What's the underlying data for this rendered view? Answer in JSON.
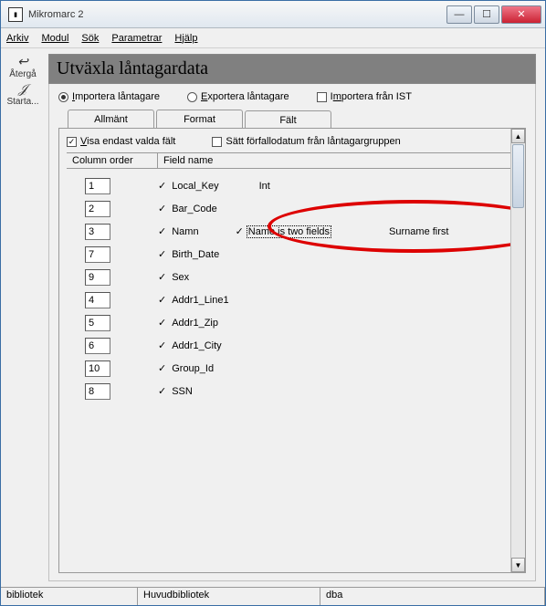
{
  "window": {
    "title": "Mikromarc 2"
  },
  "menu": {
    "arkiv": "Arkiv",
    "modul": "Modul",
    "sok": "Sök",
    "parametrar": "Parametrar",
    "hjalp": "Hjälp"
  },
  "toolbar": {
    "atergal": "Återgå",
    "starta": "Starta..."
  },
  "page_title": "Utväxla låntagardata",
  "radios": {
    "import": "Importera låntagare",
    "export": "Exportera låntagare",
    "ist": "Importera från IST"
  },
  "tabs": {
    "allmant": "Allmänt",
    "format": "Format",
    "falt": "Fält"
  },
  "options": {
    "visa_valda": "Visa endast valda fält",
    "satt_forfallo": "Sätt förfallodatum från låntagargruppen"
  },
  "grid": {
    "header": {
      "col_order": "Column order",
      "field_name": "Field name"
    },
    "rows": [
      {
        "order": "1",
        "name": "Local_Key",
        "checked": true,
        "extras": [
          {
            "label": "Int",
            "checked": false
          }
        ]
      },
      {
        "order": "2",
        "name": "Bar_Code",
        "checked": true
      },
      {
        "order": "3",
        "name": "Namn",
        "checked": true,
        "extras": [
          {
            "label": "Name is two fields",
            "checked": true,
            "focus": true
          },
          {
            "label": "Surname first",
            "checked": false
          }
        ]
      },
      {
        "order": "7",
        "name": "Birth_Date",
        "checked": true
      },
      {
        "order": "9",
        "name": "Sex",
        "checked": true
      },
      {
        "order": "4",
        "name": "Addr1_Line1",
        "checked": true
      },
      {
        "order": "5",
        "name": "Addr1_Zip",
        "checked": true
      },
      {
        "order": "6",
        "name": "Addr1_City",
        "checked": true
      },
      {
        "order": "10",
        "name": "Group_Id",
        "checked": true
      },
      {
        "order": "8",
        "name": "SSN",
        "checked": true
      }
    ]
  },
  "status": {
    "cell1": "bibliotek",
    "cell2": "Huvudbibliotek",
    "cell3": "dba"
  }
}
